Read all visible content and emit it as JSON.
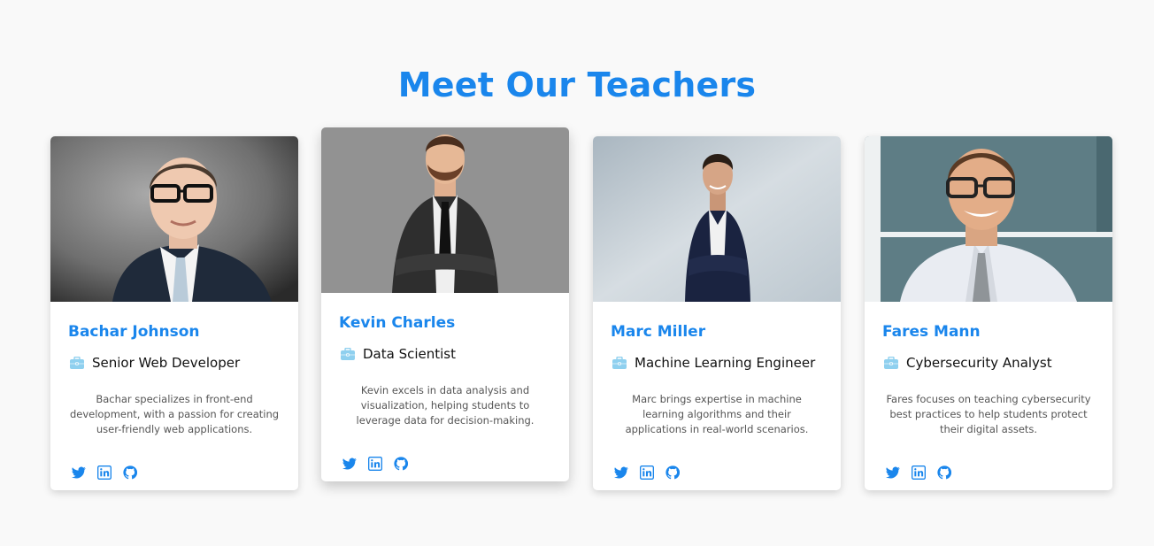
{
  "section": {
    "title": "Meet Our Teachers"
  },
  "colors": {
    "accent": "#1a86ec",
    "icon_light": "#8fd0ef",
    "bg": "#f9f9f9"
  },
  "teachers": [
    {
      "name": "Bachar Johnson",
      "role": "Senior Web Developer",
      "role_icon": "briefcase-icon",
      "description": "Bachar specializes in front-end development, with a passion for creating user-friendly web applications.",
      "socials": [
        "twitter-icon",
        "linkedin-icon",
        "github-icon"
      ]
    },
    {
      "name": "Kevin Charles",
      "role": "Data Scientist",
      "role_icon": "briefcase-icon",
      "description": "Kevin excels in data analysis and visualization, helping students to leverage data for decision-making.",
      "socials": [
        "twitter-icon",
        "linkedin-icon",
        "github-icon"
      ]
    },
    {
      "name": "Marc Miller",
      "role": "Machine Learning Engineer",
      "role_icon": "briefcase-icon",
      "description": "Marc brings expertise in machine learning algorithms and their applications in real-world scenarios.",
      "socials": [
        "twitter-icon",
        "linkedin-icon",
        "github-icon"
      ]
    },
    {
      "name": "Fares Mann",
      "role": "Cybersecurity Analyst",
      "role_icon": "briefcase-icon",
      "description": "Fares focuses on teaching cybersecurity best practices to help students protect their digital assets.",
      "socials": [
        "twitter-icon",
        "linkedin-icon",
        "github-icon"
      ]
    }
  ]
}
